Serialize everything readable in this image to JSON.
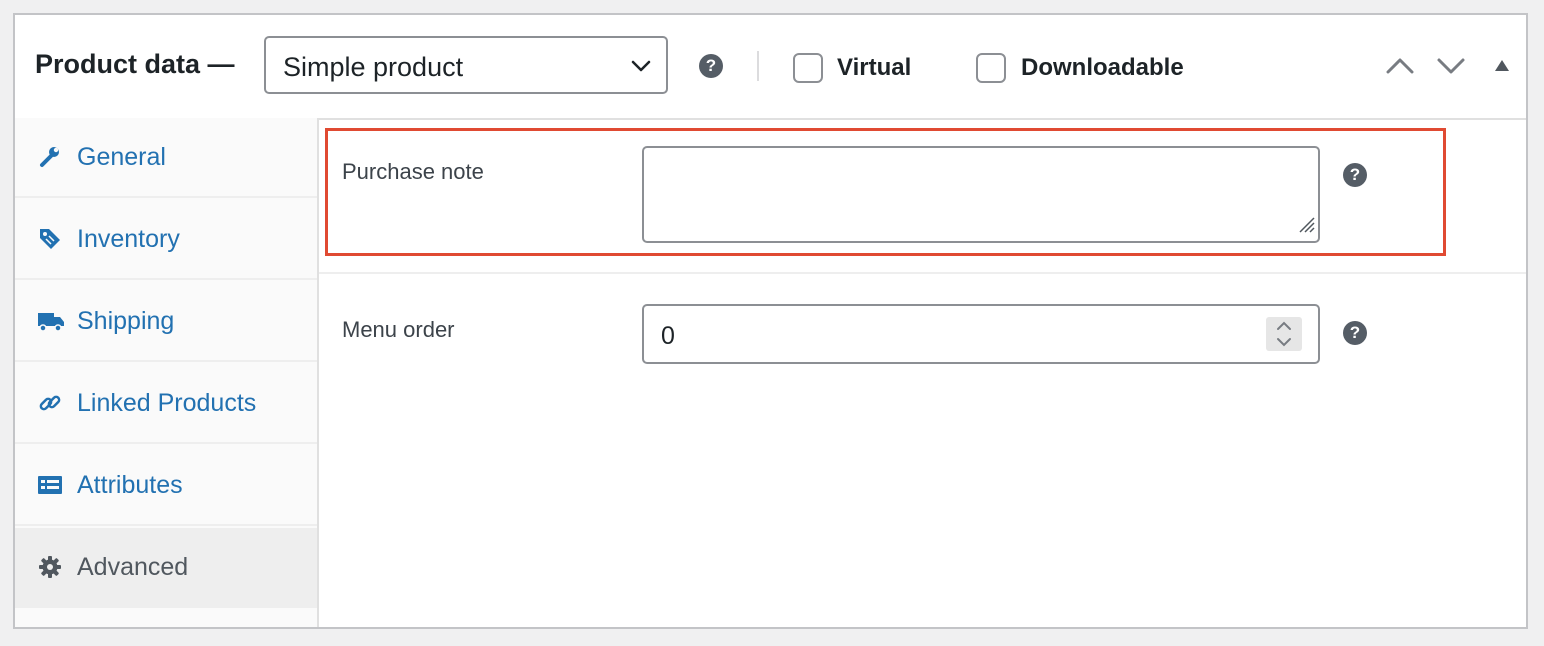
{
  "header": {
    "title": "Product data —",
    "product_type": "Simple product",
    "virtual_label": "Virtual",
    "downloadable_label": "Downloadable",
    "virtual_checked": false,
    "downloadable_checked": false
  },
  "sidebar": {
    "items": [
      {
        "label": "General",
        "icon": "wrench-icon",
        "active": false
      },
      {
        "label": "Inventory",
        "icon": "tag-icon",
        "active": false
      },
      {
        "label": "Shipping",
        "icon": "truck-icon",
        "active": false
      },
      {
        "label": "Linked Products",
        "icon": "link-icon",
        "active": false
      },
      {
        "label": "Attributes",
        "icon": "table-icon",
        "active": false
      },
      {
        "label": "Advanced",
        "icon": "gear-icon",
        "active": true
      }
    ]
  },
  "main": {
    "purchase_note": {
      "label": "Purchase note",
      "value": ""
    },
    "menu_order": {
      "label": "Menu order",
      "value": "0"
    }
  },
  "colors": {
    "link": "#2271b1",
    "highlight": "#e04a32",
    "help_icon": "#555d66"
  }
}
